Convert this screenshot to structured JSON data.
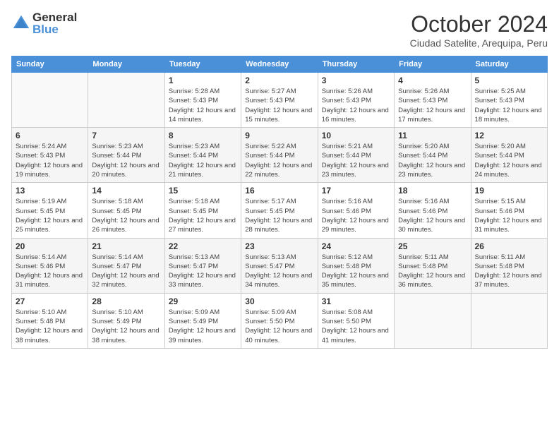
{
  "header": {
    "logo_general": "General",
    "logo_blue": "Blue",
    "month_title": "October 2024",
    "subtitle": "Ciudad Satelite, Arequipa, Peru"
  },
  "days_of_week": [
    "Sunday",
    "Monday",
    "Tuesday",
    "Wednesday",
    "Thursday",
    "Friday",
    "Saturday"
  ],
  "weeks": [
    [
      {
        "day": "",
        "sunrise": "",
        "sunset": "",
        "daylight": ""
      },
      {
        "day": "",
        "sunrise": "",
        "sunset": "",
        "daylight": ""
      },
      {
        "day": "1",
        "sunrise": "Sunrise: 5:28 AM",
        "sunset": "Sunset: 5:43 PM",
        "daylight": "Daylight: 12 hours and 14 minutes."
      },
      {
        "day": "2",
        "sunrise": "Sunrise: 5:27 AM",
        "sunset": "Sunset: 5:43 PM",
        "daylight": "Daylight: 12 hours and 15 minutes."
      },
      {
        "day": "3",
        "sunrise": "Sunrise: 5:26 AM",
        "sunset": "Sunset: 5:43 PM",
        "daylight": "Daylight: 12 hours and 16 minutes."
      },
      {
        "day": "4",
        "sunrise": "Sunrise: 5:26 AM",
        "sunset": "Sunset: 5:43 PM",
        "daylight": "Daylight: 12 hours and 17 minutes."
      },
      {
        "day": "5",
        "sunrise": "Sunrise: 5:25 AM",
        "sunset": "Sunset: 5:43 PM",
        "daylight": "Daylight: 12 hours and 18 minutes."
      }
    ],
    [
      {
        "day": "6",
        "sunrise": "Sunrise: 5:24 AM",
        "sunset": "Sunset: 5:43 PM",
        "daylight": "Daylight: 12 hours and 19 minutes."
      },
      {
        "day": "7",
        "sunrise": "Sunrise: 5:23 AM",
        "sunset": "Sunset: 5:44 PM",
        "daylight": "Daylight: 12 hours and 20 minutes."
      },
      {
        "day": "8",
        "sunrise": "Sunrise: 5:23 AM",
        "sunset": "Sunset: 5:44 PM",
        "daylight": "Daylight: 12 hours and 21 minutes."
      },
      {
        "day": "9",
        "sunrise": "Sunrise: 5:22 AM",
        "sunset": "Sunset: 5:44 PM",
        "daylight": "Daylight: 12 hours and 22 minutes."
      },
      {
        "day": "10",
        "sunrise": "Sunrise: 5:21 AM",
        "sunset": "Sunset: 5:44 PM",
        "daylight": "Daylight: 12 hours and 23 minutes."
      },
      {
        "day": "11",
        "sunrise": "Sunrise: 5:20 AM",
        "sunset": "Sunset: 5:44 PM",
        "daylight": "Daylight: 12 hours and 23 minutes."
      },
      {
        "day": "12",
        "sunrise": "Sunrise: 5:20 AM",
        "sunset": "Sunset: 5:44 PM",
        "daylight": "Daylight: 12 hours and 24 minutes."
      }
    ],
    [
      {
        "day": "13",
        "sunrise": "Sunrise: 5:19 AM",
        "sunset": "Sunset: 5:45 PM",
        "daylight": "Daylight: 12 hours and 25 minutes."
      },
      {
        "day": "14",
        "sunrise": "Sunrise: 5:18 AM",
        "sunset": "Sunset: 5:45 PM",
        "daylight": "Daylight: 12 hours and 26 minutes."
      },
      {
        "day": "15",
        "sunrise": "Sunrise: 5:18 AM",
        "sunset": "Sunset: 5:45 PM",
        "daylight": "Daylight: 12 hours and 27 minutes."
      },
      {
        "day": "16",
        "sunrise": "Sunrise: 5:17 AM",
        "sunset": "Sunset: 5:45 PM",
        "daylight": "Daylight: 12 hours and 28 minutes."
      },
      {
        "day": "17",
        "sunrise": "Sunrise: 5:16 AM",
        "sunset": "Sunset: 5:46 PM",
        "daylight": "Daylight: 12 hours and 29 minutes."
      },
      {
        "day": "18",
        "sunrise": "Sunrise: 5:16 AM",
        "sunset": "Sunset: 5:46 PM",
        "daylight": "Daylight: 12 hours and 30 minutes."
      },
      {
        "day": "19",
        "sunrise": "Sunrise: 5:15 AM",
        "sunset": "Sunset: 5:46 PM",
        "daylight": "Daylight: 12 hours and 31 minutes."
      }
    ],
    [
      {
        "day": "20",
        "sunrise": "Sunrise: 5:14 AM",
        "sunset": "Sunset: 5:46 PM",
        "daylight": "Daylight: 12 hours and 31 minutes."
      },
      {
        "day": "21",
        "sunrise": "Sunrise: 5:14 AM",
        "sunset": "Sunset: 5:47 PM",
        "daylight": "Daylight: 12 hours and 32 minutes."
      },
      {
        "day": "22",
        "sunrise": "Sunrise: 5:13 AM",
        "sunset": "Sunset: 5:47 PM",
        "daylight": "Daylight: 12 hours and 33 minutes."
      },
      {
        "day": "23",
        "sunrise": "Sunrise: 5:13 AM",
        "sunset": "Sunset: 5:47 PM",
        "daylight": "Daylight: 12 hours and 34 minutes."
      },
      {
        "day": "24",
        "sunrise": "Sunrise: 5:12 AM",
        "sunset": "Sunset: 5:48 PM",
        "daylight": "Daylight: 12 hours and 35 minutes."
      },
      {
        "day": "25",
        "sunrise": "Sunrise: 5:11 AM",
        "sunset": "Sunset: 5:48 PM",
        "daylight": "Daylight: 12 hours and 36 minutes."
      },
      {
        "day": "26",
        "sunrise": "Sunrise: 5:11 AM",
        "sunset": "Sunset: 5:48 PM",
        "daylight": "Daylight: 12 hours and 37 minutes."
      }
    ],
    [
      {
        "day": "27",
        "sunrise": "Sunrise: 5:10 AM",
        "sunset": "Sunset: 5:48 PM",
        "daylight": "Daylight: 12 hours and 38 minutes."
      },
      {
        "day": "28",
        "sunrise": "Sunrise: 5:10 AM",
        "sunset": "Sunset: 5:49 PM",
        "daylight": "Daylight: 12 hours and 38 minutes."
      },
      {
        "day": "29",
        "sunrise": "Sunrise: 5:09 AM",
        "sunset": "Sunset: 5:49 PM",
        "daylight": "Daylight: 12 hours and 39 minutes."
      },
      {
        "day": "30",
        "sunrise": "Sunrise: 5:09 AM",
        "sunset": "Sunset: 5:50 PM",
        "daylight": "Daylight: 12 hours and 40 minutes."
      },
      {
        "day": "31",
        "sunrise": "Sunrise: 5:08 AM",
        "sunset": "Sunset: 5:50 PM",
        "daylight": "Daylight: 12 hours and 41 minutes."
      },
      {
        "day": "",
        "sunrise": "",
        "sunset": "",
        "daylight": ""
      },
      {
        "day": "",
        "sunrise": "",
        "sunset": "",
        "daylight": ""
      }
    ]
  ]
}
